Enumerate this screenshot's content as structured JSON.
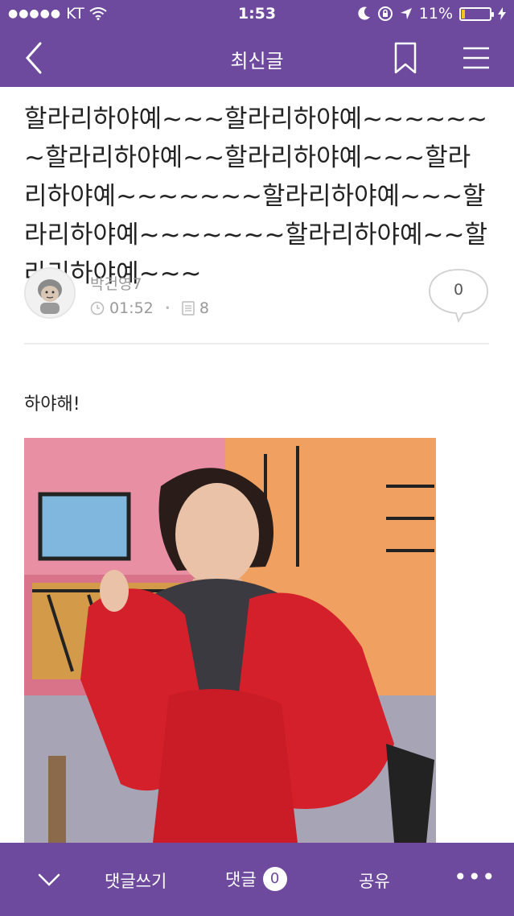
{
  "status_bar": {
    "carrier": "KT",
    "time": "1:53",
    "battery": "11%",
    "battery_level": 0.11
  },
  "nav": {
    "title": "최신글"
  },
  "post": {
    "headline": "할라리하야예~~~할라리하야예~~~~~~~할라리하야예~~할라리하야예~~~할라리하야예~~~~~~~할라리하야예~~~할라리하야예~~~~~~~할라리하야예~~할라리하야예~~~",
    "author": "박건영7",
    "time": "01:52",
    "views": "8",
    "comment_count": "0",
    "body": "하야해!"
  },
  "bottom_bar": {
    "write_label": "댓글쓰기",
    "comments_label": "댓글",
    "comments_count": "0",
    "share_label": "공유",
    "more_label": "•••"
  },
  "colors": {
    "brand": "#6d4a9e",
    "battery": "#f5c518"
  }
}
